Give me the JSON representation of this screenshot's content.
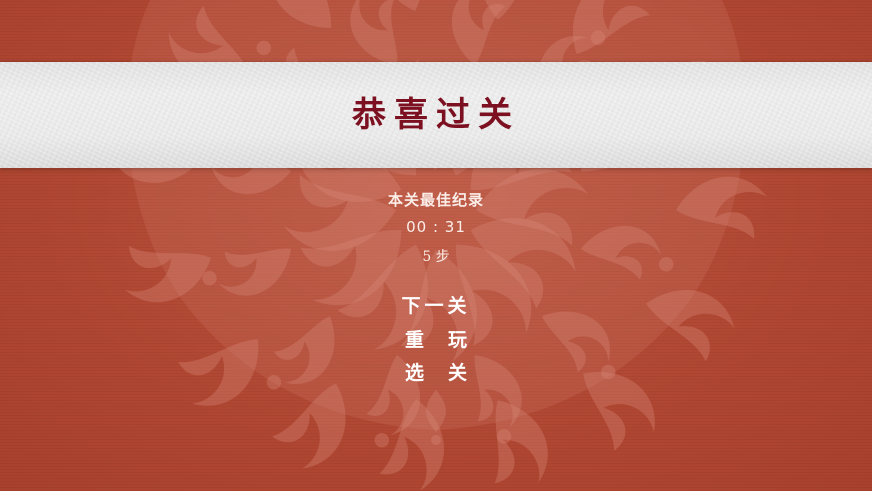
{
  "banner": {
    "title": "恭喜过关"
  },
  "record": {
    "label": "本关最佳纪录",
    "time": "00 : 31",
    "steps": "5 步"
  },
  "menu": {
    "next_level": "下一关",
    "replay": "重玩",
    "select_level": "选关"
  },
  "colors": {
    "background": "#b34a36",
    "ornament": "#d7867a",
    "banner": "#e8e8e8",
    "title": "#7c1020",
    "text": "#ffffff"
  }
}
